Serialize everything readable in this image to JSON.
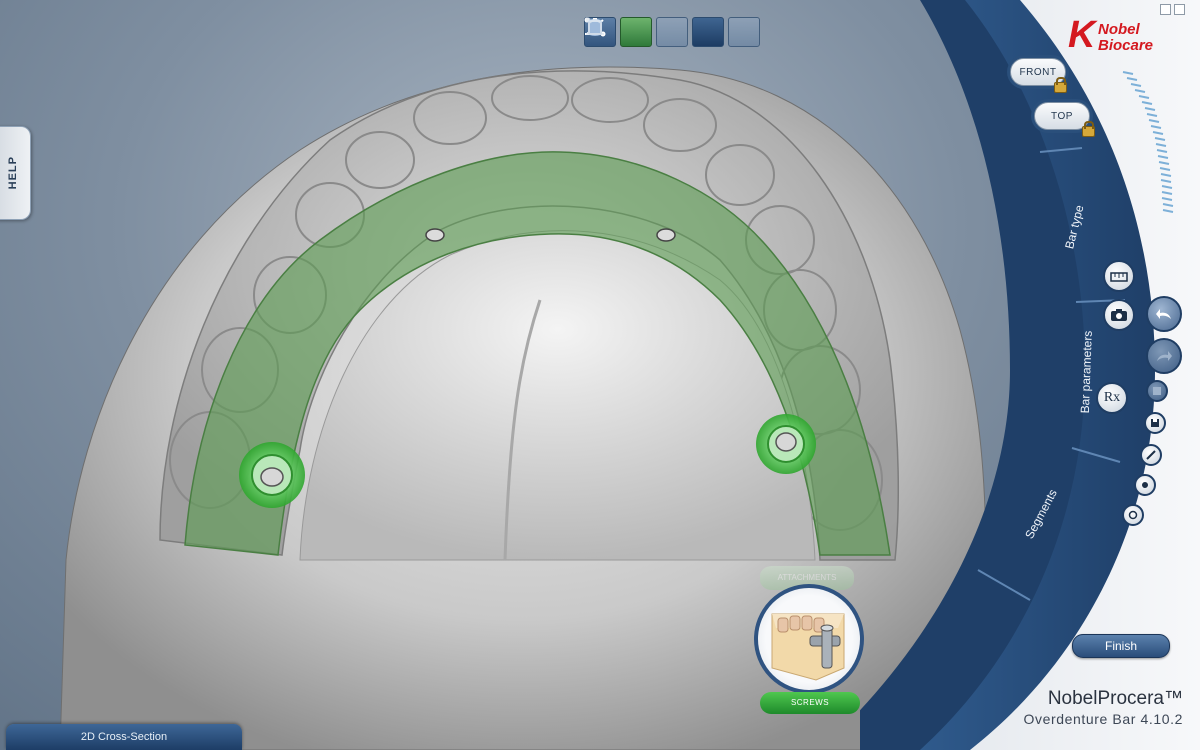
{
  "toolbar": {
    "buttons": [
      {
        "name": "bar-height-tool",
        "state": "normal"
      },
      {
        "name": "connect-tool",
        "state": "active"
      },
      {
        "name": "disconnect-tool",
        "state": "dim"
      },
      {
        "name": "cylinder-view-tool",
        "state": "dark"
      },
      {
        "name": "clearance-tool",
        "state": "dim"
      }
    ]
  },
  "help": {
    "label": "HELP"
  },
  "cross_section": {
    "label": "2D Cross-Section"
  },
  "brand": {
    "mark": "K",
    "line1": "Nobel",
    "line2": "Biocare",
    "color": "#d41920"
  },
  "views": {
    "front": "FRONT",
    "top": "TOP"
  },
  "steps": {
    "bar_type": "Bar type",
    "bar_parameters": "Bar parameters",
    "segments": "Segments"
  },
  "tools": {
    "ruler_icon": "ruler-icon",
    "camera_icon": "camera-icon",
    "rx_label": "Rx",
    "undo_icon": "undo-icon",
    "redo_icon": "redo-icon"
  },
  "finish": {
    "label": "Finish"
  },
  "product": {
    "name": "NobelProcera™",
    "version": "Overdenture Bar 4.10.2"
  },
  "thumbnail": {
    "top_label": "ATTACHMENTS",
    "bottom_label": "SCREWS"
  },
  "colors": {
    "panel_dark": "#1f3f68",
    "panel_mid": "#2f5a8c",
    "bar_green": "#5d9c54",
    "active_green": "#3fae3f"
  }
}
